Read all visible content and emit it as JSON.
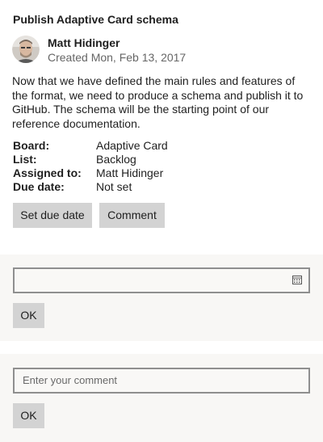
{
  "card": {
    "title": "Publish Adaptive Card schema",
    "author": "Matt Hidinger",
    "created": "Created Mon, Feb 13, 2017",
    "description": "Now that we have defined the main rules and features of the format, we need to produce a schema and publish it to GitHub. The schema will be the starting point of our reference documentation.",
    "facts": [
      {
        "key": "Board:",
        "value": "Adaptive Card"
      },
      {
        "key": "List:",
        "value": "Backlog"
      },
      {
        "key": "Assigned to:",
        "value": "Matt Hidinger"
      },
      {
        "key": "Due date:",
        "value": "Not set"
      }
    ],
    "actions": {
      "set_due_date": "Set due date",
      "comment": "Comment"
    }
  },
  "due_date_panel": {
    "value": "",
    "ok_label": "OK",
    "icon": "calendar-icon"
  },
  "comment_panel": {
    "placeholder": "Enter your comment",
    "ok_label": "OK"
  },
  "colors": {
    "panel_bg": "#f8f7f5",
    "button_bg": "#d3d3d3",
    "input_border": "#8f8f8f"
  }
}
